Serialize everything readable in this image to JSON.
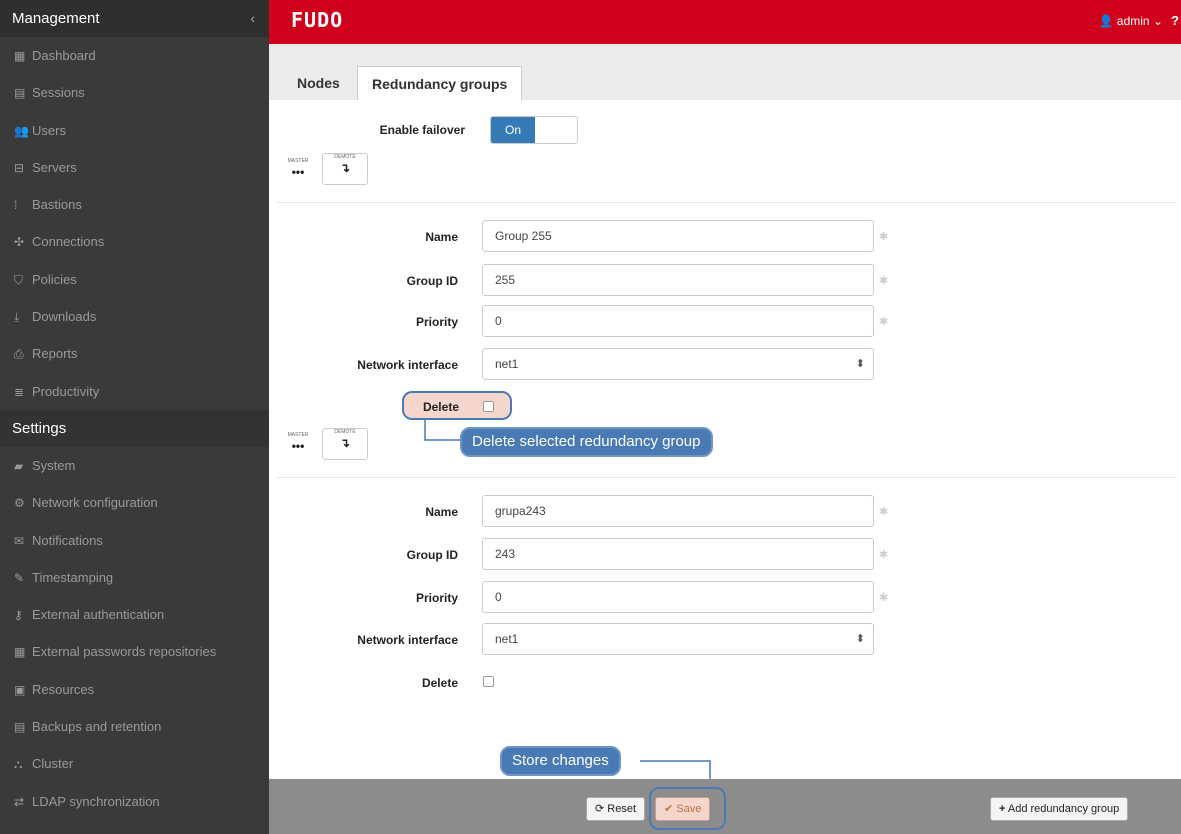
{
  "sidebar": {
    "header": "Management",
    "collapse_icon": "‹",
    "management_items": [
      {
        "icon": "▦",
        "label": "Dashboard"
      },
      {
        "icon": "▤",
        "label": "Sessions"
      },
      {
        "icon": "👥",
        "label": "Users"
      },
      {
        "icon": "⊟",
        "label": "Servers"
      },
      {
        "icon": "⁞",
        "label": "Bastions"
      },
      {
        "icon": "✣",
        "label": "Connections"
      },
      {
        "icon": "⛉",
        "label": "Policies"
      },
      {
        "icon": "⤓",
        "label": "Downloads"
      },
      {
        "icon": "⎙",
        "label": "Reports"
      },
      {
        "icon": "≣",
        "label": "Productivity"
      }
    ],
    "settings_header": "Settings",
    "settings_items": [
      {
        "icon": "▰",
        "label": "System"
      },
      {
        "icon": "⚙",
        "label": "Network configuration"
      },
      {
        "icon": "✉",
        "label": "Notifications"
      },
      {
        "icon": "✎",
        "label": "Timestamping"
      },
      {
        "icon": "⚷",
        "label": "External authentication"
      },
      {
        "icon": "▦",
        "label": "External passwords repositories"
      },
      {
        "icon": "▣",
        "label": "Resources"
      },
      {
        "icon": "▤",
        "label": "Backups and retention"
      },
      {
        "icon": "⛬",
        "label": "Cluster"
      },
      {
        "icon": "⇄",
        "label": "LDAP synchronization"
      }
    ]
  },
  "topbar": {
    "logo": "FUDO",
    "user": "admin",
    "user_icon": "👤",
    "help": "?"
  },
  "tabs": [
    {
      "label": "Nodes",
      "active": false
    },
    {
      "label": "Redundancy groups",
      "active": true
    }
  ],
  "failover": {
    "label": "Enable failover",
    "toggle_on": "On"
  },
  "node_legend": {
    "master_label": "MASTER",
    "master_value": "•••",
    "demote_label": "DEMOTE",
    "demote_value": "↴"
  },
  "groups": [
    {
      "name_label": "Name",
      "name": "Group 255",
      "group_id_label": "Group ID",
      "group_id": "255",
      "priority_label": "Priority",
      "priority": "0",
      "iface_label": "Network interface",
      "iface": "net1",
      "delete_label": "Delete"
    },
    {
      "name_label": "Name",
      "name": "grupa243",
      "group_id_label": "Group ID",
      "group_id": "243",
      "priority_label": "Priority",
      "priority": "0",
      "iface_label": "Network interface",
      "iface": "net1",
      "delete_label": "Delete"
    }
  ],
  "callouts": {
    "delete": "Delete selected redundancy group",
    "store": "Store changes"
  },
  "footer": {
    "reset": "Reset",
    "save": "Save",
    "add": "Add redundancy group"
  },
  "colors": {
    "brand_red": "#d0021b",
    "sidebar_bg": "#3a3a3a",
    "primary_blue": "#337ab7",
    "callout_blue": "#4a7ab5"
  }
}
